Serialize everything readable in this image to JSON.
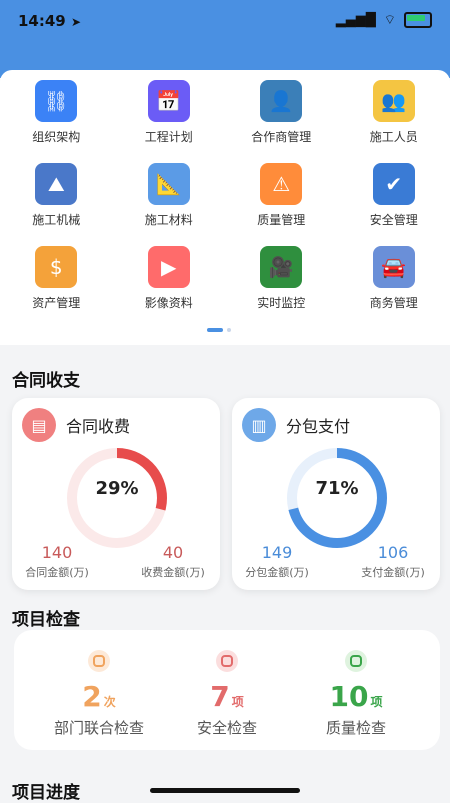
{
  "status": {
    "time": "14:49",
    "signal": "signal-icon",
    "wifi": "wifi-icon",
    "battery": "battery-icon",
    "location": "location-arrow-icon"
  },
  "grid": [
    {
      "label": "组织架构",
      "icon": "org-chart-icon",
      "color": "#3b82f6",
      "glyph": "⛓"
    },
    {
      "label": "工程计划",
      "icon": "calendar-icon",
      "color": "#6b5cf6",
      "glyph": "📅"
    },
    {
      "label": "合作商管理",
      "icon": "partner-icon",
      "color": "#3b7fb8",
      "glyph": "👤"
    },
    {
      "label": "施工人员",
      "icon": "workers-icon",
      "color": "#f4c542",
      "glyph": "👥"
    },
    {
      "label": "施工机械",
      "icon": "machinery-icon",
      "color": "#4a78c9",
      "glyph": "⛰"
    },
    {
      "label": "施工材料",
      "icon": "materials-icon",
      "color": "#5b9be6",
      "glyph": "📐"
    },
    {
      "label": "质量管理",
      "icon": "quality-icon",
      "color": "#ff8c3a",
      "glyph": "⚠"
    },
    {
      "label": "安全管理",
      "icon": "shield-icon",
      "color": "#3a7bd5",
      "glyph": "✔"
    },
    {
      "label": "资产管理",
      "icon": "asset-icon",
      "color": "#f4a23a",
      "glyph": "$"
    },
    {
      "label": "影像资料",
      "icon": "media-icon",
      "color": "#ff6b6b",
      "glyph": "▶"
    },
    {
      "label": "实时监控",
      "icon": "video-camera-icon",
      "color": "#2f8f3e",
      "glyph": "🎥"
    },
    {
      "label": "商务管理",
      "icon": "business-icon",
      "color": "#6a8fd8",
      "glyph": "🚘"
    }
  ],
  "contract": {
    "section_title": "合同收支",
    "income_card": {
      "title": "合同收费",
      "percent_label": "29%",
      "percent": 29,
      "color": "#e74c4c",
      "left_value": "140",
      "left_label": "合同金额(万)",
      "right_value": "40",
      "right_label": "收费金额(万)"
    },
    "payment_card": {
      "title": "分包支付",
      "percent_label": "71%",
      "percent": 71,
      "color": "#4a90e2",
      "left_value": "149",
      "left_label": "分包金额(万)",
      "right_value": "106",
      "right_label": "支付金额(万)"
    }
  },
  "inspection": {
    "section_title": "项目检查",
    "items": [
      {
        "count": "2",
        "unit": "次",
        "label": "部门联合检查",
        "color": "#f0a35e"
      },
      {
        "count": "7",
        "unit": "项",
        "label": "安全检查",
        "color": "#e26b6b"
      },
      {
        "count": "10",
        "unit": "项",
        "label": "质量检查",
        "color": "#3aa54a"
      }
    ]
  },
  "progress": {
    "section_title": "项目进度"
  }
}
